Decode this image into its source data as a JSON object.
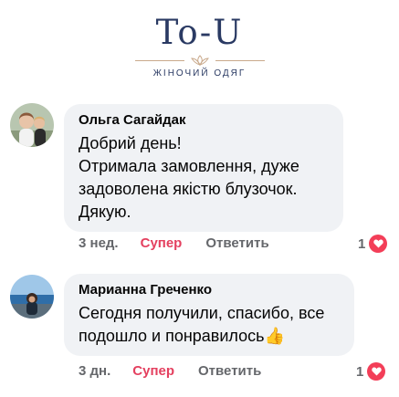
{
  "logo": {
    "title": "To-U",
    "subtitle": "ЖІНОЧИЙ ОДЯГ"
  },
  "comments": [
    {
      "author": "Ольга Сагайдак",
      "text": "Добрий день!\nОтримала замовлення, дуже задоволена якістю  блузочок.\nДякую.",
      "time": "3 нед.",
      "like_label": "Супер",
      "reply_label": "Ответить",
      "reaction_count": "1",
      "reaction_icon": "heart-icon"
    },
    {
      "author": "Марианна Греченко",
      "text": "Сегодня получили, спасибо, все подошло и понравилось",
      "emoji": "👍",
      "time": "3 дн.",
      "like_label": "Супер",
      "reply_label": "Ответить",
      "reaction_count": "1",
      "reaction_icon": "heart-icon"
    }
  ],
  "colors": {
    "brand_navy": "#2a3a63",
    "bubble_bg": "#f0f2f5",
    "like_active": "#e4405f",
    "heart": "#f33e58",
    "secondary_text": "#65676b"
  }
}
